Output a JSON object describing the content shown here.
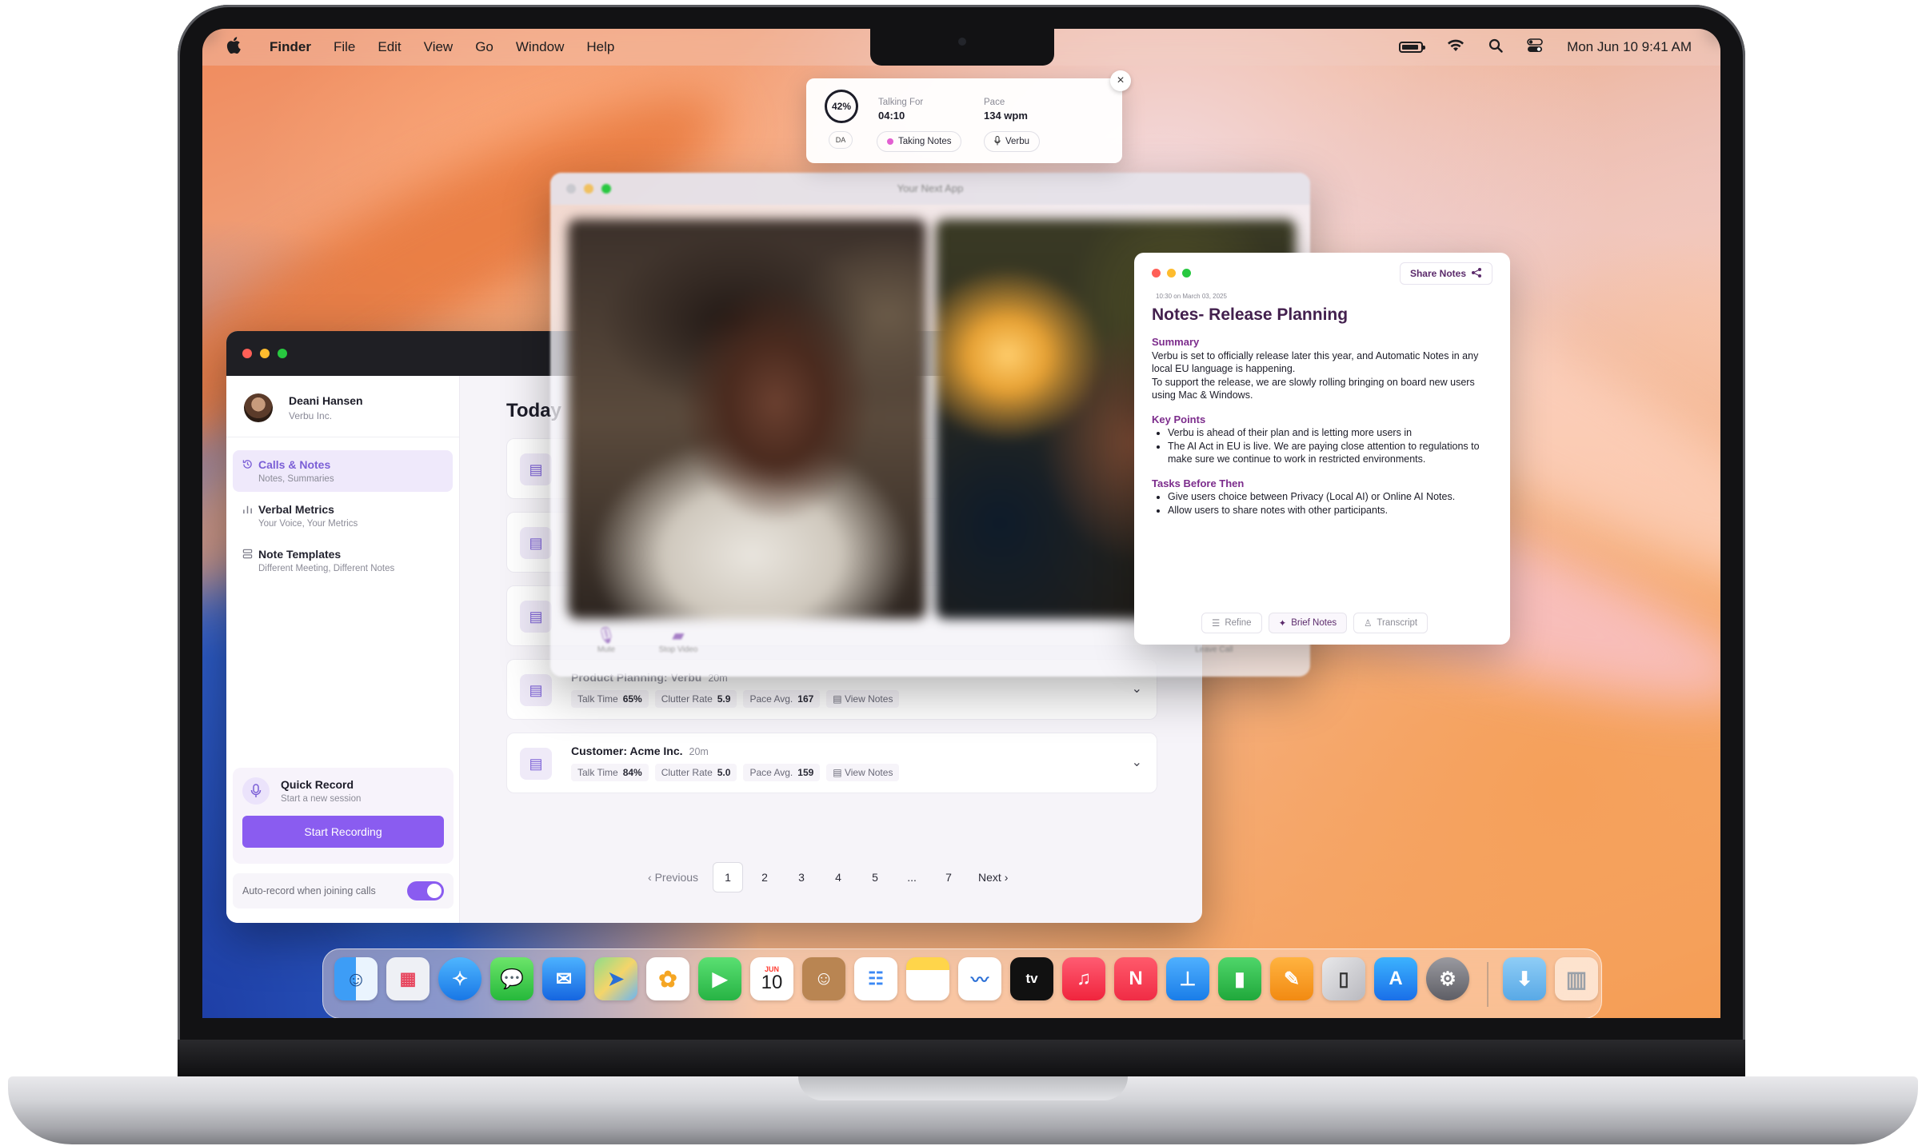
{
  "menubar": {
    "apple": "",
    "app": "Finder",
    "items": [
      "File",
      "Edit",
      "View",
      "Go",
      "Window",
      "Help"
    ],
    "clock": "Mon Jun 10  9:41 AM"
  },
  "widget": {
    "percent": "42%",
    "initials": "DA",
    "talking_label": "Talking For",
    "talking_value": "04:10",
    "pace_label": "Pace",
    "pace_value": "134 wpm",
    "taking_notes": "Taking Notes",
    "verbu": "Verbu",
    "close": "×"
  },
  "call": {
    "title": "Your Next App",
    "buttons": [
      "Mute",
      "Stop Video",
      "Leave Call"
    ]
  },
  "app": {
    "user": {
      "name": "Deani Hansen",
      "org": "Verbu Inc."
    },
    "nav": [
      {
        "title": "Calls & Notes",
        "sub": "Notes, Summaries"
      },
      {
        "title": "Verbal Metrics",
        "sub": "Your Voice, Your Metrics"
      },
      {
        "title": "Note Templates",
        "sub": "Different Meeting, Different Notes"
      }
    ],
    "quick": {
      "title": "Quick Record",
      "sub": "Start a new session",
      "button": "Start Recording"
    },
    "auto_record": "Auto-record when joining calls",
    "heading": "Today",
    "rows": [
      {
        "title": "Product Planning: Verbu",
        "dur": "20m",
        "talk": "65%",
        "clutter": "5.9",
        "pace": "167"
      },
      {
        "title": "Customer: Acme Inc.",
        "dur": "20m",
        "talk": "84%",
        "clutter": "5.0",
        "pace": "159"
      }
    ],
    "metric_labels": {
      "talk": "Talk Time",
      "clutter": "Clutter Rate",
      "pace": "Pace Avg.",
      "view": "View Notes"
    },
    "pager": {
      "prev": "Previous",
      "pages": [
        "1",
        "2",
        "3",
        "4",
        "5",
        "...",
        "7"
      ],
      "next": "Next"
    }
  },
  "notes": {
    "share": "Share Notes",
    "date": "10:30 on March 03, 2025",
    "title": "Notes- Release Planning",
    "summary_h": "Summary",
    "summary": "Verbu is set to officially release later this year, and Automatic Notes in any local EU language is happening.",
    "summary2": "To support the release, we are slowly rolling bringing on board new users using Mac & Windows.",
    "key_h": "Key Points",
    "key": [
      "Verbu is ahead of their plan and is letting more users in",
      "The AI Act in EU is live. We are paying close attention to regulations to make sure we continue to work in restricted environments."
    ],
    "tasks_h": "Tasks Before Then",
    "tasks": [
      "Give users choice between Privacy (Local AI) or Online AI Notes.",
      "Allow users to share notes with other participants."
    ],
    "footer": [
      "Refine",
      "Brief Notes",
      "Transcript"
    ]
  },
  "dock": {
    "calendar_month": "JUN",
    "calendar_day": "10",
    "tv": "tv"
  }
}
